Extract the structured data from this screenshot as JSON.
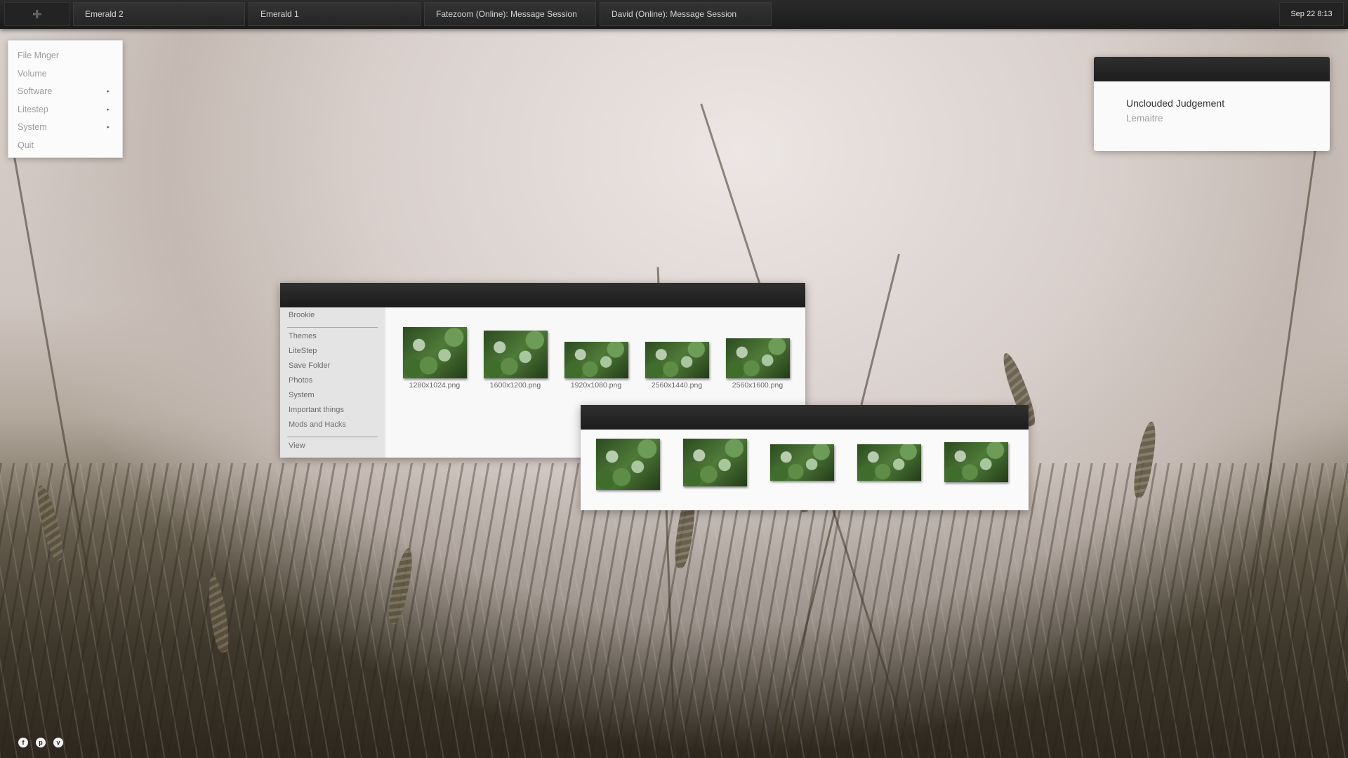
{
  "taskbar": {
    "start_icon": "➕",
    "tasks": [
      "Emerald 2",
      "Emerald 1",
      "Fatezoom (Online): Message Session",
      "David (Online): Message Session"
    ],
    "clock": "Sep 22  8:13"
  },
  "menu": {
    "items": [
      {
        "label": "File Mnger",
        "submenu": false
      },
      {
        "label": "Volume",
        "submenu": false
      },
      {
        "label": "Software",
        "submenu": true
      },
      {
        "label": "Litestep",
        "submenu": true
      },
      {
        "label": "System",
        "submenu": true
      },
      {
        "label": "Quit",
        "submenu": false
      }
    ],
    "arrow": "▸"
  },
  "now_playing": {
    "title": "Unclouded Judgement",
    "artist": "Lemaitre"
  },
  "file_window": {
    "sidebar": {
      "header": "Brookie",
      "items": [
        "Themes",
        "LiteStep",
        "Save Folder",
        "Photos",
        "System",
        "Important things",
        "Mods and Hacks"
      ],
      "footer": "View"
    },
    "files": [
      "1280x1024.png",
      "1600x1200.png",
      "1920x1080.png",
      "2560x1440.png",
      "2560x1600.png"
    ]
  },
  "social": [
    "f",
    "p",
    "v"
  ],
  "icons": {
    "start": "plus-icon",
    "submenu": "arrow-right-icon",
    "social": [
      "facebook-icon",
      "pinterest-icon",
      "vimeo-icon"
    ]
  }
}
